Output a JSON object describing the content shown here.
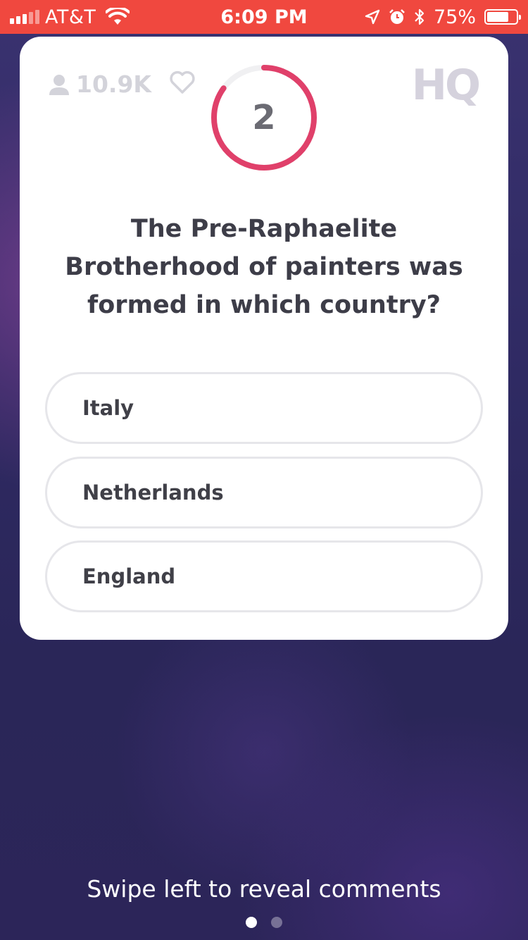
{
  "status_bar": {
    "carrier": "AT&T",
    "time": "6:09 PM",
    "battery_percent": "75%",
    "battery_level": 0.75,
    "icons": [
      "signal-icon",
      "wifi-icon",
      "location-icon",
      "alarm-icon",
      "bluetooth-icon",
      "battery-icon"
    ]
  },
  "header": {
    "viewer_count": "10.9K",
    "logo": "HQ"
  },
  "timer": {
    "seconds": "2",
    "progress_remaining": 0.85,
    "color": "#e0406a"
  },
  "question": {
    "text": "The Pre-Raphaelite Brotherhood of painters was formed in which country?"
  },
  "answers": [
    {
      "label": "Italy"
    },
    {
      "label": "Netherlands"
    },
    {
      "label": "England"
    }
  ],
  "footer": {
    "swipe_hint": "Swipe left to reveal comments",
    "pages": 2,
    "active_page": 1
  },
  "colors": {
    "status_bar": "#f0483f",
    "background": "#2f2a63",
    "card": "#ffffff",
    "question_text": "#3d3d48"
  }
}
